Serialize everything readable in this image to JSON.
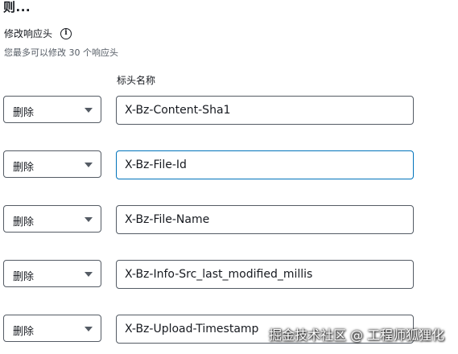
{
  "section": {
    "title": "则...",
    "subtitle": "修改响应头",
    "hint": "您最多可以修改 30 个响应头",
    "info_icon_glyph": "i"
  },
  "columns": {
    "header_name": "标头名称"
  },
  "rows": [
    {
      "action": "删除",
      "header_name": "X-Bz-Content-Sha1",
      "focused": false
    },
    {
      "action": "删除",
      "header_name": "X-Bz-File-Id",
      "focused": true
    },
    {
      "action": "删除",
      "header_name": "X-Bz-File-Name",
      "focused": false
    },
    {
      "action": "删除",
      "header_name": "X-Bz-Info-Src_last_modified_millis",
      "focused": false
    },
    {
      "action": "删除",
      "header_name": "X-Bz-Upload-Timestamp",
      "focused": false
    }
  ],
  "watermark": "掘金技术社区 @ 工程师狐狸化",
  "colors": {
    "focus_border": "#0073bb",
    "input_border": "#545b64",
    "text": "#16191f"
  }
}
